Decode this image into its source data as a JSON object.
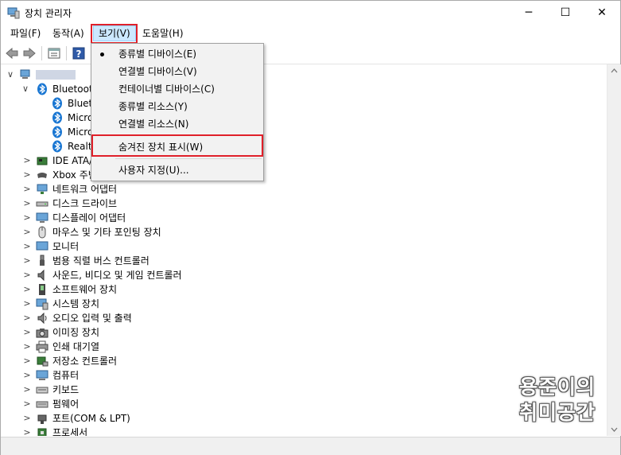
{
  "window": {
    "title": "장치 관리자",
    "minimize_glyph": "─",
    "maximize_glyph": "☐",
    "close_glyph": "✕"
  },
  "menubar": {
    "items": [
      {
        "label": "파일(F)"
      },
      {
        "label": "동작(A)"
      },
      {
        "label": "보기(V)"
      },
      {
        "label": "도움말(H)"
      }
    ]
  },
  "dropdown": {
    "items": [
      {
        "label": "종류별 디바이스(E)",
        "checked": true
      },
      {
        "label": "연결별 디바이스(V)",
        "checked": false
      },
      {
        "label": "컨테이너별 디바이스(C)",
        "checked": false
      },
      {
        "label": "종류별 리소스(Y)",
        "checked": false
      },
      {
        "label": "연결별 리소스(N)",
        "checked": false
      },
      {
        "label": "숨겨진 장치 표시(W)",
        "checked": false
      },
      {
        "label": "사용자 지정(U)...",
        "checked": false
      }
    ]
  },
  "tree": {
    "root_chevron": "∨",
    "expanded_chevron": "∨",
    "collapsed_chevron": ">",
    "bluetooth": {
      "label": "Bluetooth",
      "children": [
        "Blueto",
        "Micro",
        "Micro",
        "Realte"
      ]
    },
    "categories": [
      {
        "label": "IDE ATA/",
        "icon": "ide-controller-icon"
      },
      {
        "label": "Xbox 주변",
        "icon": "xbox-peripheral-icon"
      },
      {
        "label": "네트워크 어댑터",
        "icon": "network-adapter-icon"
      },
      {
        "label": "디스크 드라이브",
        "icon": "disk-drive-icon"
      },
      {
        "label": "디스플레이 어댑터",
        "icon": "display-adapter-icon"
      },
      {
        "label": "마우스 및 기타 포인팅 장치",
        "icon": "mouse-icon"
      },
      {
        "label": "모니터",
        "icon": "monitor-icon"
      },
      {
        "label": "범용 직렬 버스 컨트롤러",
        "icon": "usb-icon"
      },
      {
        "label": "사운드, 비디오 및 게임 컨트롤러",
        "icon": "speaker-icon"
      },
      {
        "label": "소프트웨어 장치",
        "icon": "software-device-icon"
      },
      {
        "label": "시스템 장치",
        "icon": "system-device-icon"
      },
      {
        "label": "오디오 입력 및 출력",
        "icon": "audio-io-icon"
      },
      {
        "label": "이미징 장치",
        "icon": "camera-icon"
      },
      {
        "label": "인쇄 대기열",
        "icon": "printer-icon"
      },
      {
        "label": "저장소 컨트롤러",
        "icon": "storage-controller-icon"
      },
      {
        "label": "컴퓨터",
        "icon": "computer-icon"
      },
      {
        "label": "키보드",
        "icon": "keyboard-icon"
      },
      {
        "label": "펌웨어",
        "icon": "firmware-icon"
      },
      {
        "label": "포트(COM & LPT)",
        "icon": "port-icon"
      },
      {
        "label": "프로세서",
        "icon": "processor-icon"
      }
    ]
  },
  "watermark": {
    "line1": "용준이의",
    "line2": "취미공간"
  },
  "colors": {
    "highlight_red": "#e0202a",
    "menu_open_bg": "#cce8ff",
    "bluetooth_blue": "#1976d2"
  }
}
